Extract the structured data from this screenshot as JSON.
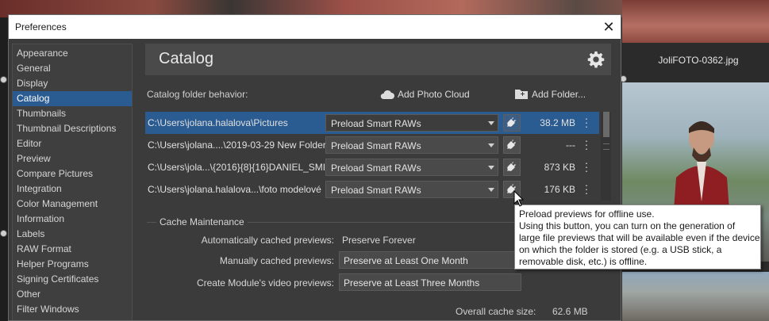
{
  "dialog": {
    "title": "Preferences",
    "close_glyph": "✕"
  },
  "sidebar": {
    "items": [
      {
        "label": "Appearance"
      },
      {
        "label": "General"
      },
      {
        "label": "Display"
      },
      {
        "label": "Catalog",
        "active": true
      },
      {
        "label": "Thumbnails"
      },
      {
        "label": "Thumbnail Descriptions"
      },
      {
        "label": "Editor"
      },
      {
        "label": "Preview"
      },
      {
        "label": "Compare Pictures"
      },
      {
        "label": "Integration"
      },
      {
        "label": "Color Management"
      },
      {
        "label": "Information"
      },
      {
        "label": "Labels"
      },
      {
        "label": "RAW Format"
      },
      {
        "label": "Helper Programs"
      },
      {
        "label": "Signing Certificates"
      },
      {
        "label": "Other"
      },
      {
        "label": "Filter Windows"
      }
    ]
  },
  "catalog": {
    "header": "Catalog",
    "behavior_label": "Catalog folder behavior:",
    "add_cloud_label": "Add Photo Cloud",
    "add_folder_label": "Add Folder...",
    "folders": [
      {
        "path": "C:\\Users\\jolana.halalova\\Pictures",
        "mode": "Preload Smart RAWs",
        "size": "38.2 MB",
        "selected": true
      },
      {
        "path": "C:\\Users\\jolana....\\2019-03-29 New Folder",
        "mode": "Preload Smart RAWs",
        "size": "---"
      },
      {
        "path": "C:\\Users\\jola...\\{2016}{8}{16}DANIEL_SMID",
        "mode": "Preload Smart RAWs",
        "size": "873 KB"
      },
      {
        "path": "C:\\Users\\jolana.halalova...\\foto modelové",
        "mode": "Preload Smart RAWs",
        "size": "176 KB"
      }
    ],
    "cache": {
      "section_label": "Cache Maintenance",
      "auto_label": "Automatically cached previews:",
      "auto_value": "Preserve Forever",
      "manual_label": "Manually cached previews:",
      "manual_value": "Preserve at Least One Month",
      "video_label": "Create Module's video previews:",
      "video_value": "Preserve at Least Three Months",
      "overall_label": "Overall cache size:",
      "overall_value": "62.6 MB"
    }
  },
  "tooltip": {
    "lines": [
      "Preload previews for offline use.",
      "Using this button, you can turn on the generation of",
      "large file previews that will be available even if the device",
      "on which the folder is stored (e.g. a USB stick, a",
      "removable disk, etc.) is offline."
    ]
  },
  "background": {
    "photo_filename": "JoliFOTO-0362.jpg"
  },
  "colors": {
    "accent": "#2a5b91",
    "dialog_bg": "#3b3b3b"
  },
  "icons": {
    "gear": "gear-icon",
    "cloud": "cloud-icon",
    "folder_add": "folder-add-icon",
    "plug": "plug-icon",
    "more": "kebab-icon"
  }
}
